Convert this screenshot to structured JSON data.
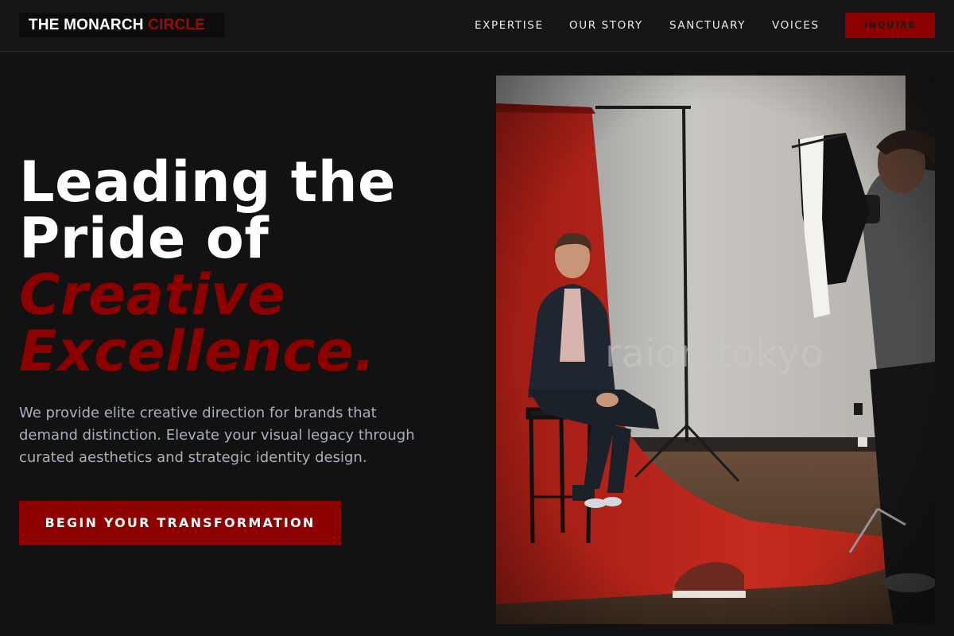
{
  "nav": {
    "logo_main": "THE MONARCH ",
    "logo_accent": "CIRCLE",
    "links": [
      "EXPERTISE",
      "OUR STORY",
      "SANCTUARY",
      "VOICES"
    ],
    "cta_label": "INQUIRE"
  },
  "hero": {
    "headline_line1": "Leading the",
    "headline_line2": "Pride of",
    "headline_accent1": "Creative",
    "headline_accent2": "Excellence.",
    "subtext": "We provide elite creative direction for brands that demand distinction. Elevate your visual legacy through curated aesthetics and strategic identity design.",
    "cta_label": "BEGIN YOUR TRANSFORMATION"
  },
  "photo": {
    "watermark": "raion.tokyo"
  },
  "colors": {
    "background": "#121212",
    "accent": "#8c0000",
    "text": "#ffffff",
    "muted_text": "#a9b0bd"
  }
}
